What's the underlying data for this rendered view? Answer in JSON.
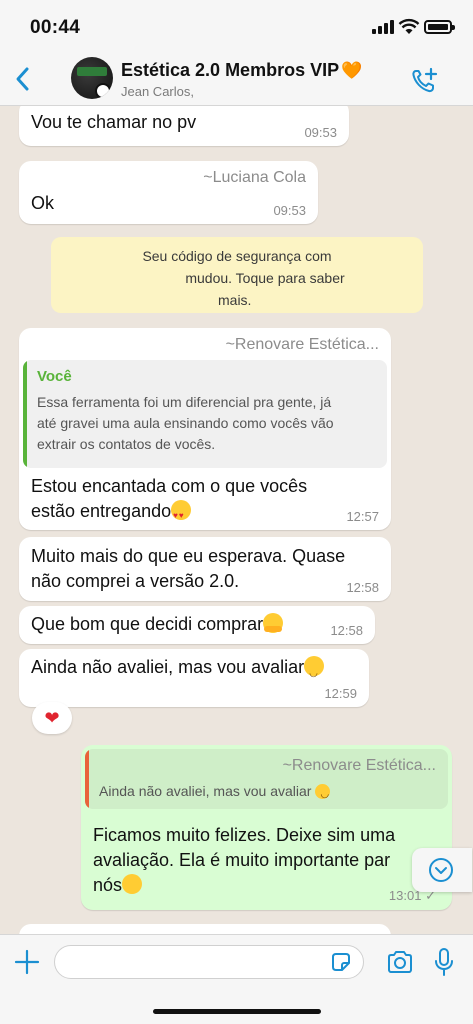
{
  "status_bar": {
    "time": "00:44"
  },
  "header": {
    "title": "Estética 2.0 Membros VIP",
    "title_emoji": "🧡",
    "subtitle": "Jean Carlos,"
  },
  "messages": [
    {
      "text": "Vou te chamar no pv",
      "time": "09:53"
    },
    {
      "sender": "~Luciana Cola",
      "text": "Ok",
      "time": "09:53"
    },
    {
      "sender": "~Renovare Estética...",
      "quote_name": "Você",
      "quote_text": [
        "Essa ferramenta foi um diferencial pra gente, já",
        "até gravei uma aula ensinando como vocês vão",
        "extrair os contatos de vocês."
      ],
      "text_lines": [
        "Estou encantada com o que vocês",
        "estão entregando"
      ],
      "time": "12:57"
    },
    {
      "text_lines": [
        "Muito mais do que eu esperava. Quase",
        "não comprei a versão 2.0."
      ],
      "time": "12:58"
    },
    {
      "text": "Que bom que decidi comprar",
      "time": "12:58"
    },
    {
      "text": "Ainda não avaliei, mas vou avaliar",
      "time": "12:59",
      "reaction": "❤"
    },
    {
      "outgoing": true,
      "quote_sender": "~Renovare Estética...",
      "quote_text": "Ainda não avaliei, mas vou avaliar",
      "text_lines": [
        "Ficamos muito felizes. Deixe sim uma",
        "avaliação. Ela é muito importante par",
        "nós"
      ],
      "time": "13:01"
    }
  ],
  "system_notice": {
    "lines": [
      "Seu código de segurança com",
      "mudou. Toque para saber",
      "mais."
    ]
  },
  "colors": {
    "accent": "#1b8fd1",
    "outgoing_bubble": "#d9fdd3",
    "quote_bar_green": "#59b33a",
    "quote_bar_orange": "#e8623a",
    "system_bg": "#fcf4c4"
  },
  "icons": [
    "back-chevron-icon",
    "add-call-icon",
    "plus-icon",
    "sticker-icon",
    "camera-icon",
    "microphone-icon",
    "chevron-down-icon"
  ]
}
